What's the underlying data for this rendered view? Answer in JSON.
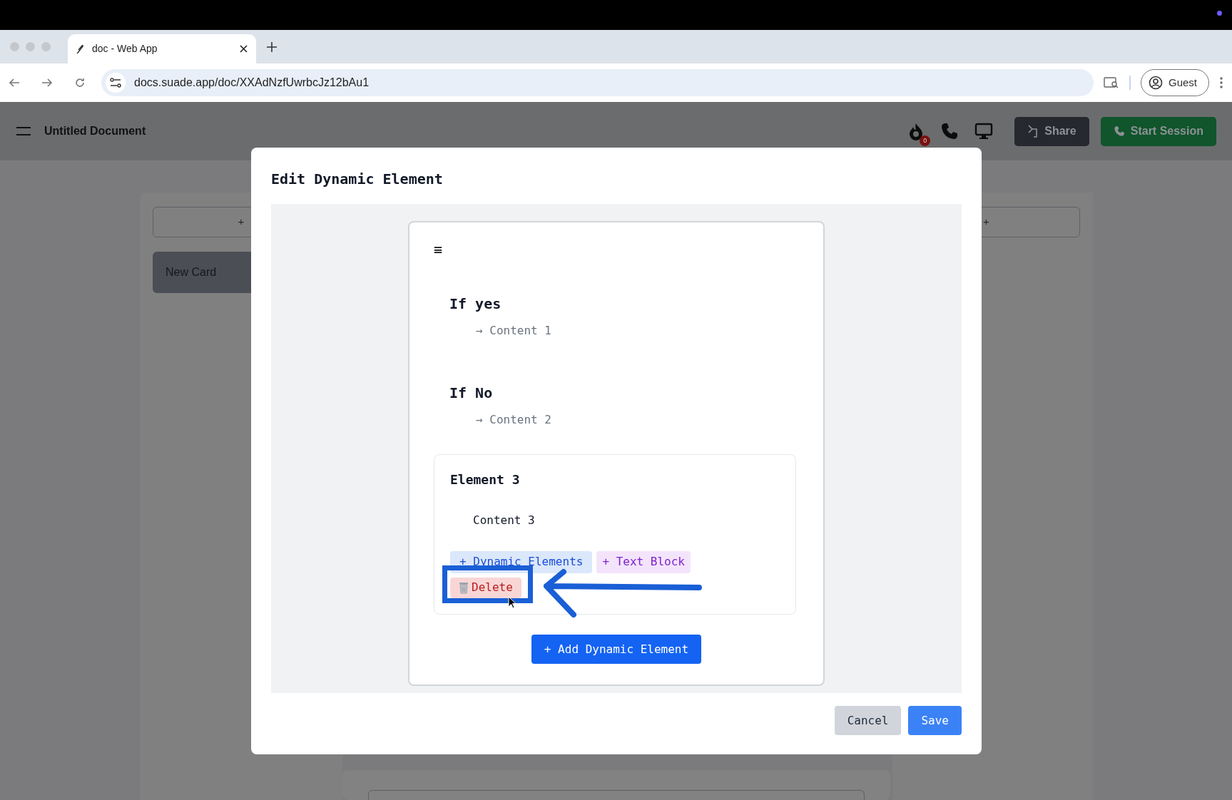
{
  "browser": {
    "tab_title": "doc - Web App",
    "url": "docs.suade.app/doc/XXAdNzfUwrbcJz12bAu1",
    "profile": "Guest"
  },
  "app_header": {
    "title": "Untitled Document",
    "notification_count": "0",
    "buttons": [
      {
        "label": "Share",
        "kind": "share"
      },
      {
        "label": "Start Session",
        "kind": "session"
      }
    ]
  },
  "board": {
    "left_add": "+",
    "card": "New Card",
    "right_add": "+"
  },
  "modal": {
    "title": "Edit Dynamic Element",
    "menu_glyph": "≡",
    "sections": [
      {
        "heading": "If yes",
        "content": "→ Content 1"
      },
      {
        "heading": "If No",
        "content": "→ Content 2"
      }
    ],
    "element": {
      "heading": "Element 3",
      "content": "Content 3",
      "actions": [
        {
          "label": "+ Dynamic Elements",
          "kind": "dynamic"
        },
        {
          "label": "+ Text Block",
          "kind": "text"
        },
        {
          "label": "Delete",
          "kind": "delete"
        }
      ]
    },
    "add_button": "+ Add Dynamic Element",
    "footer_buttons": [
      {
        "label": "Cancel",
        "kind": "secondary"
      },
      {
        "label": "Save",
        "kind": "primary"
      }
    ]
  }
}
